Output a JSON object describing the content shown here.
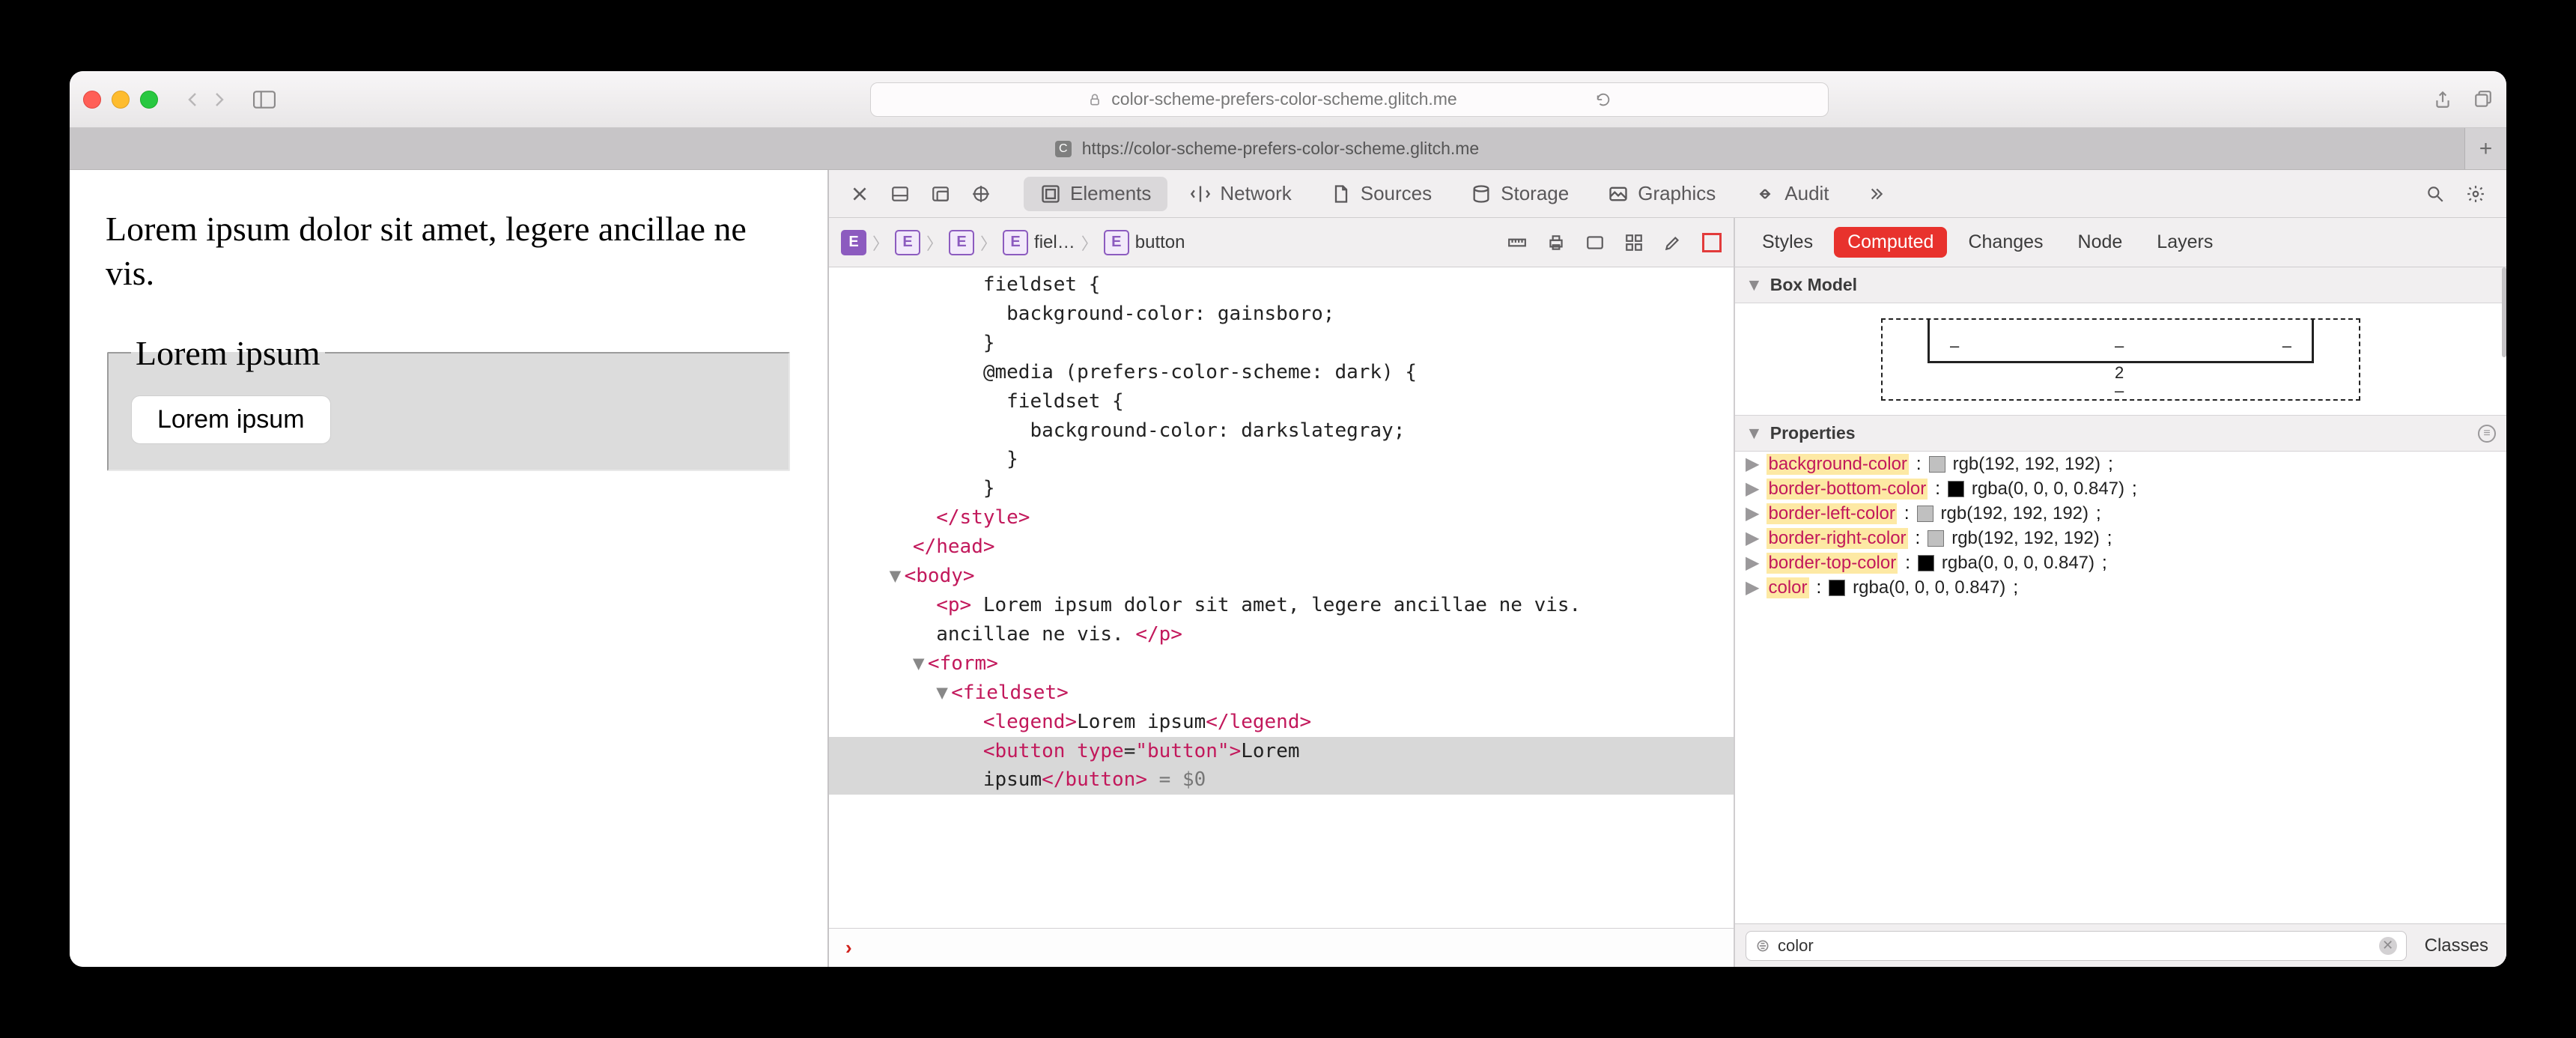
{
  "browser": {
    "url_host": "color-scheme-prefers-color-scheme.glitch.me",
    "tab_label": "https://color-scheme-prefers-color-scheme.glitch.me",
    "tab_favicon_letter": "C"
  },
  "page": {
    "paragraph": "Lorem ipsum dolor sit amet, legere ancillae ne vis.",
    "legend": "Lorem ipsum",
    "button": "Lorem ipsum"
  },
  "devtools": {
    "tabs": {
      "elements": "Elements",
      "network": "Network",
      "sources": "Sources",
      "storage": "Storage",
      "graphics": "Graphics",
      "audit": "Audit"
    },
    "breadcrumb": {
      "fieldset": "fiel…",
      "button": "button"
    },
    "dom_lines": [
      {
        "indent": 10,
        "text": "fieldset {"
      },
      {
        "indent": 12,
        "text": "background-color: gainsboro;"
      },
      {
        "indent": 10,
        "text": "}"
      },
      {
        "indent": 10,
        "text": "@media (prefers-color-scheme: dark) {"
      },
      {
        "indent": 12,
        "text": "fieldset {"
      },
      {
        "indent": 14,
        "text": "background-color: darkslategray;"
      },
      {
        "indent": 12,
        "text": "}"
      },
      {
        "indent": 10,
        "text": "}"
      }
    ],
    "closing_style": "</style>",
    "closing_head": "</head>",
    "open_body": "<body>",
    "p_open": "<p>",
    "p_text": " Lorem ipsum dolor sit amet, legere ancillae ne vis. ",
    "p_close": "</p>",
    "form_open": "<form>",
    "fieldset_open": "<fieldset>",
    "legend_open": "<legend>",
    "legend_text": "Lorem ipsum",
    "legend_close": "</legend>",
    "button_open": "<button",
    "button_attr_name": "type",
    "button_attr_val": "\"button\"",
    "button_close_gt": ">",
    "button_text": "Lorem ipsum",
    "button_close": "</button>",
    "dollar0": " = $0",
    "styles_tabs": {
      "styles": "Styles",
      "computed": "Computed",
      "changes": "Changes",
      "node": "Node",
      "layers": "Layers"
    },
    "section_boxmodel": "Box Model",
    "boxmodel_value": "2",
    "section_properties": "Properties",
    "properties": [
      {
        "name": "background-color",
        "swatch": "#C0C0C0",
        "value": "rgb(192, 192, 192)"
      },
      {
        "name": "border-bottom-color",
        "swatch": "#000000",
        "value": "rgba(0, 0, 0, 0.847)"
      },
      {
        "name": "border-left-color",
        "swatch": "#C0C0C0",
        "value": "rgb(192, 192, 192)"
      },
      {
        "name": "border-right-color",
        "swatch": "#C0C0C0",
        "value": "rgb(192, 192, 192)"
      },
      {
        "name": "border-top-color",
        "swatch": "#000000",
        "value": "rgba(0, 0, 0, 0.847)"
      },
      {
        "name": "color",
        "swatch": "#000000",
        "value": "rgba(0, 0, 0, 0.847)"
      }
    ],
    "filter_value": "color",
    "classes_btn": "Classes"
  }
}
